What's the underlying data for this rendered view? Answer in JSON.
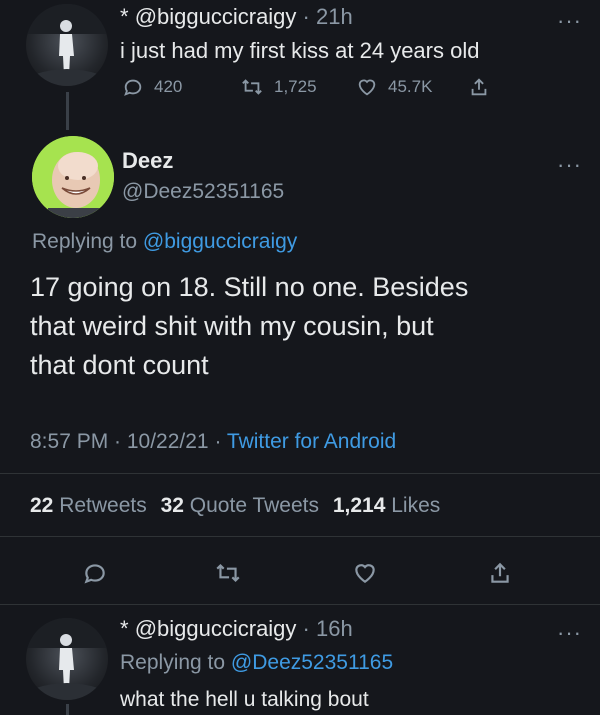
{
  "tweet1": {
    "star": "*",
    "handle": "@bigguccicraigy",
    "time": "· 21h",
    "text": "i just had my first kiss at 24 years old",
    "replies": "420",
    "retweets": "1,725",
    "likes": "45.7K"
  },
  "main": {
    "name": "Deez",
    "handle": "@Deez52351165",
    "replying_prefix": "Replying to",
    "replying_handle": "@bigguccicraigy",
    "text_line1": "17 going on 18. Still no one. Besides",
    "text_line2": "that weird shit with my cousin, but",
    "text_line3": "that dont count",
    "timestamp": "8:57 PM · 10/22/21 ·",
    "source": "Twitter for Android",
    "stats": {
      "retweets_count": "22",
      "retweets_label": "Retweets",
      "quotes_count": "32",
      "quotes_label": "Quote Tweets",
      "likes_count": "1,214",
      "likes_label": "Likes"
    }
  },
  "tweet3": {
    "star": "*",
    "handle": "@bigguccicraigy",
    "time": "· 16h",
    "replying_prefix": "Replying to",
    "replying_handle": "@Deez52351165",
    "text": "what the hell u talking bout"
  },
  "more_glyph": "···",
  "icons": [
    "reply-icon",
    "retweet-icon",
    "like-icon",
    "share-icon",
    "more-icon"
  ],
  "colors": {
    "background": "#15171c",
    "text": "#e7e9ea",
    "muted": "#8b98a5",
    "link": "#3f9be3",
    "avatar_green": "#a6e34f"
  }
}
